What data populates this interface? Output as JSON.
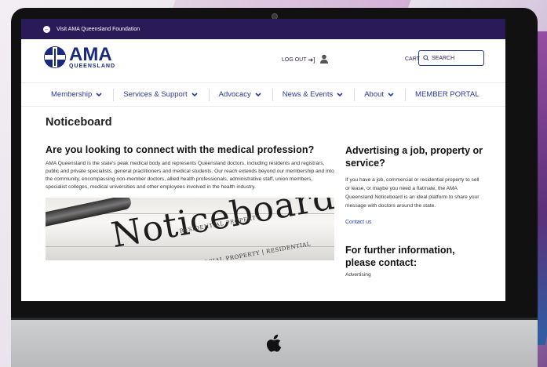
{
  "topbar": {
    "text": "Visit AMA Queensland Foundation"
  },
  "header": {
    "logo_main": "AMA",
    "logo_sub": "QUEENSLAND",
    "logout": "LOG OUT",
    "cart": "CART",
    "search_placeholder": "SEARCH"
  },
  "nav": {
    "items": [
      {
        "label": "Membership",
        "has_dropdown": true
      },
      {
        "label": "Services & Support",
        "has_dropdown": true
      },
      {
        "label": "Advocacy",
        "has_dropdown": true
      },
      {
        "label": "News & Events",
        "has_dropdown": true
      },
      {
        "label": "About",
        "has_dropdown": true
      },
      {
        "label": "MEMBER PORTAL",
        "has_dropdown": false
      }
    ]
  },
  "page": {
    "title": "Noticeboard",
    "main_heading": "Are you looking to connect with the medical profession?",
    "main_body": "AMA Queensland is the state's peak medical body and represents Queensland doctors, including residents and registrars, public and private specialists, general practitioners and medical students. Our reach extends beyond our membership and into the community, encompassing non-member doctors, allied health professionals, administrative staff, union members, specialist colleges, medical universities and other employees involved in the health industry.",
    "image_word": "Noticeboard",
    "image_strip_top": "RESIDENTIAL PROPERTY",
    "image_strip_bottom": "JOBS | COMMERCIAL PROPERTY | RESIDENTIAL PROPERTY"
  },
  "sidebar": {
    "heading": "Advertising a job, property or service?",
    "body": "If you have a job, commercial or residential property to sell or lease, or maybe you need a flatmate, the AMA Queensland Noticeboard is an ideal platform to share your message with doctors around the state.",
    "contact_link": "Contact us",
    "heading2": "For further information, please contact:",
    "sub": "Advertising"
  },
  "colors": {
    "topbar_bg": "#2a1a57",
    "brand_blue": "#1a2a7a",
    "nav_text": "#2a3a9a",
    "link": "#2a3ab0"
  }
}
